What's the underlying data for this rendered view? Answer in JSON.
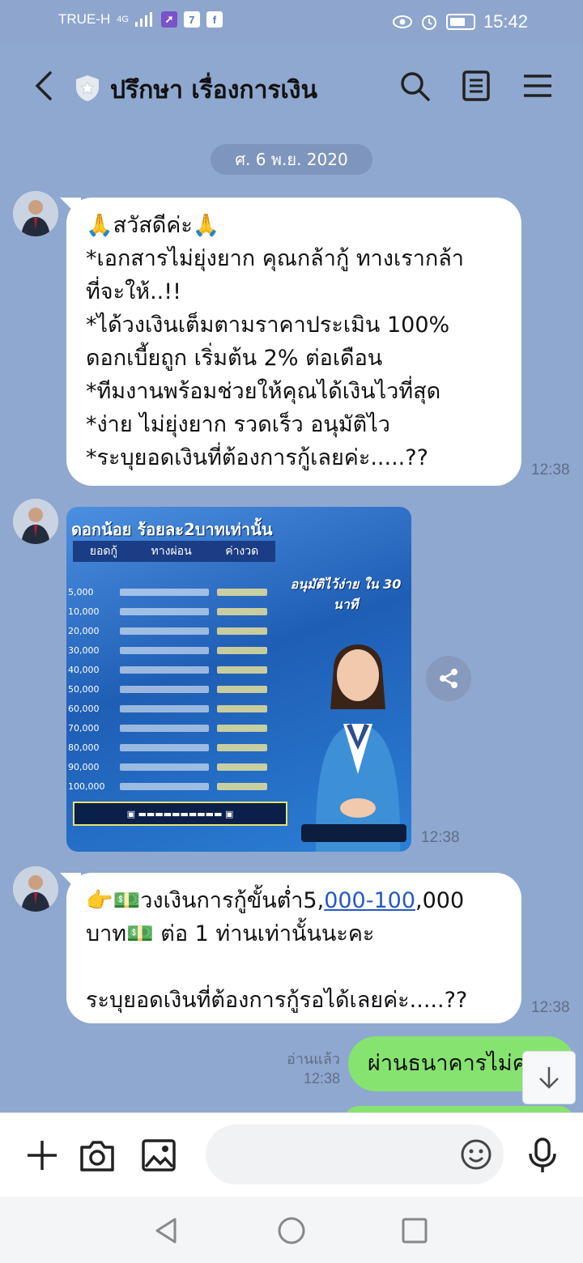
{
  "status_bar": {
    "carrier": "TRUE-H",
    "network": "4G",
    "time": "15:42"
  },
  "header": {
    "title": "ปรึกษา เรื่องการเงิน"
  },
  "date_divider": "ศ. 6 พ.ย. 2020",
  "messages": [
    {
      "lines": [
        "🙏สวัสดีค่ะ🙏",
        "*เอกสารไม่ยุ่งยาก คุณกล้ากู้ ทางเรากล้า",
        "ที่จะให้..!!",
        "*ได้วงเงินเต็มตามราคาประเมิน 100%",
        "ดอกเบี้ยถูก เริ่มต้น 2% ต่อเดือน",
        "*ทีมงานพร้อมช่วยให้คุณได้เงินไวที่สุด",
        "*ง่าย ไม่ยุ่งยาก รวดเร็ว อนุมัติไว",
        "*ระบุยอดเงินที่ต้องการกู้เลยค่ะ.....??"
      ],
      "time": "12:38"
    },
    {
      "poster": {
        "headline": "ดอกน้อย ร้อยละ2บาทเท่านั้น",
        "columns": [
          "ยอดกู้",
          "ทางผ่อน",
          "ค่างวด"
        ],
        "amounts": [
          "5,000",
          "10,000",
          "20,000",
          "30,000",
          "40,000",
          "50,000",
          "60,000",
          "70,000",
          "80,000",
          "90,000",
          "100,000"
        ],
        "slogan": "อนุมัติไว้ง่าย ใน 30 นาที"
      },
      "time": "12:38"
    },
    {
      "line1_prefix": "👉💵วงเงินการกู้ขั้นต่ำ5,",
      "line1_link": "000-100",
      "line1_suffix": ",000",
      "line2": "บาท💵 ต่อ 1 ท่านเท่านั้นนะคะ",
      "line3": "ระบุยอดเงินที่ต้องการกู้รอได้เลยค่ะ.....??",
      "time": "12:38"
    }
  ],
  "my_message": {
    "read_label": "อ่านแล้ว",
    "time": "12:38",
    "text": "ผ่านธนาคารไม่ค"
  },
  "colors": {
    "background": "#8fa8cf",
    "my_bubble": "#86e370",
    "link": "#2458c9"
  }
}
